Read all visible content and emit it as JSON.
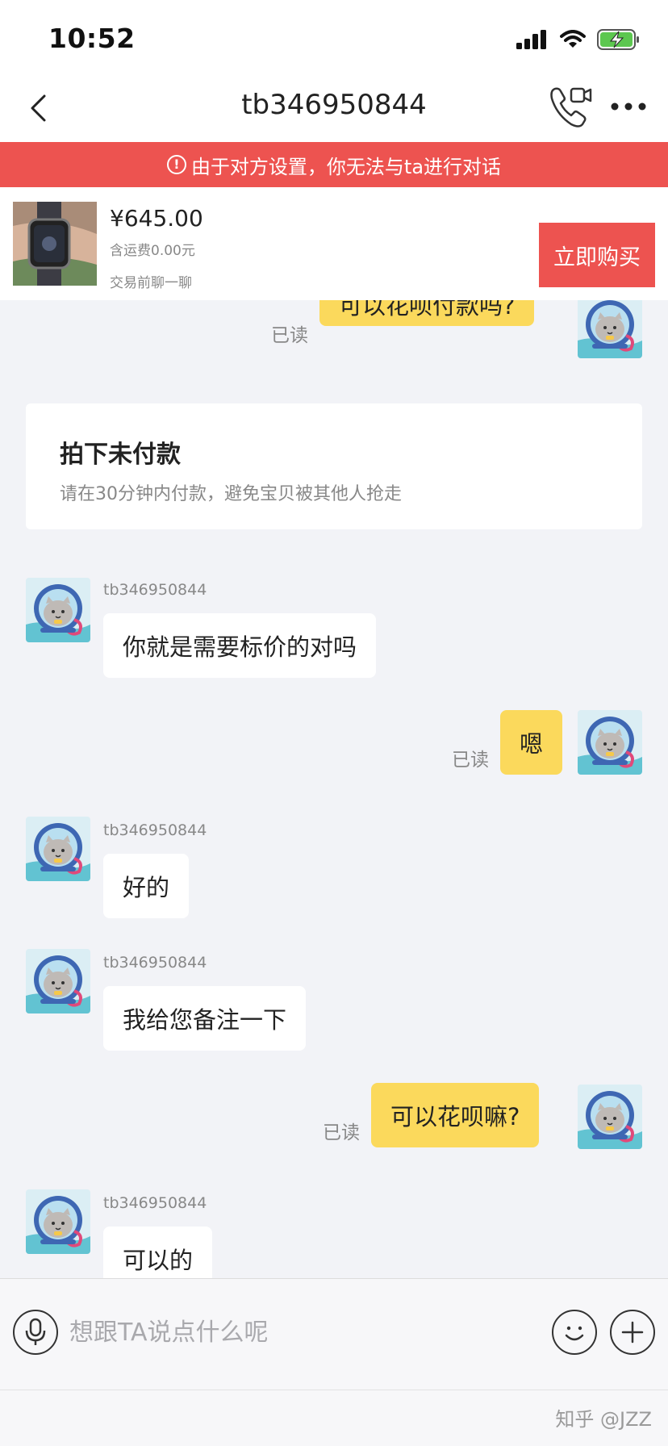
{
  "status_bar": {
    "time": "10:52"
  },
  "nav": {
    "title": "tb346950844"
  },
  "warning": {
    "text": "由于对方设置，你无法与ta进行对话"
  },
  "product": {
    "price": "¥645.00",
    "shipping": "含运费0.00元",
    "chat_first": "交易前聊一聊",
    "buy_label": "立即购买"
  },
  "chat": {
    "read_label": "已读",
    "sender_name": "tb346950844",
    "msg_1": "可以花呗付款吗?",
    "notice_title": "拍下未付款",
    "notice_desc": "请在30分钟内付款，避免宝贝被其他人抢走",
    "msg_2": "你就是需要标价的对吗",
    "msg_3": "嗯",
    "msg_4": "好的",
    "msg_5": "我给您备注一下",
    "msg_6": "可以花呗嘛?",
    "msg_7": "可以的"
  },
  "input": {
    "placeholder": "想跟TA说点什么呢"
  },
  "watermark": "知乎 @JZZ",
  "colors": {
    "accent_red": "#ed5350",
    "my_bubble": "#fbd95c",
    "background": "#f2f3f7"
  },
  "icons": [
    "back-chevron-icon",
    "video-call-icon",
    "more-dots-icon",
    "warning-circle-icon",
    "microphone-icon",
    "emoji-smile-icon",
    "plus-icon",
    "cellular-signal-icon",
    "wifi-icon",
    "battery-charging-icon"
  ]
}
